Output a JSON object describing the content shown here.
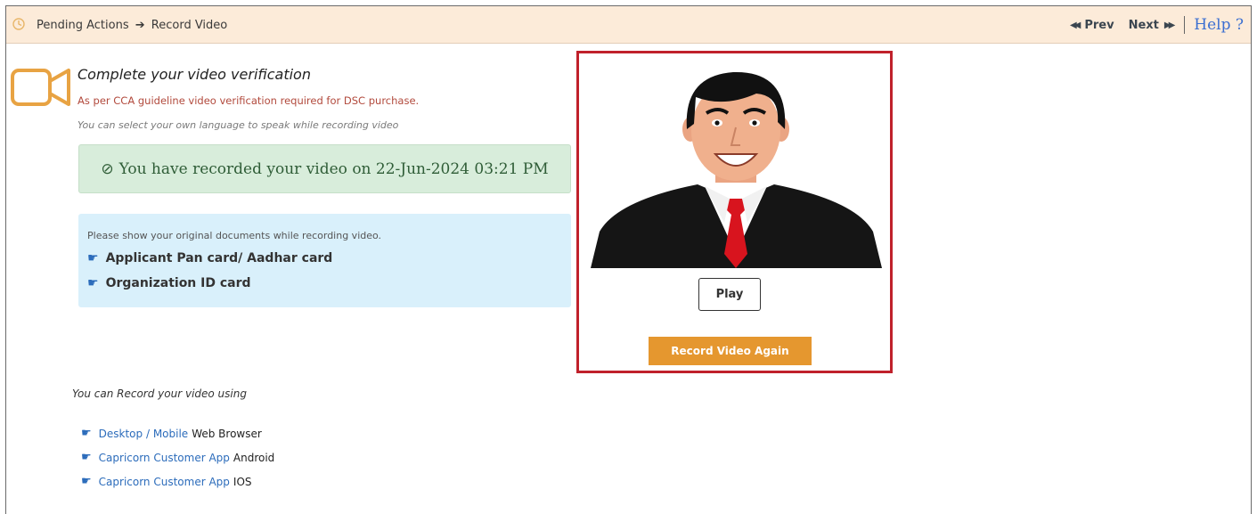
{
  "breadcrumb": {
    "parent": "Pending Actions",
    "current": "Record Video"
  },
  "nav": {
    "prev": "Prev",
    "next": "Next",
    "help": "Help ?"
  },
  "verification": {
    "title": "Complete your video verification",
    "requirement": "As per CCA guideline video verification required for DSC purchase.",
    "language_note": "You can select your own language to speak while recording video"
  },
  "status": {
    "message": "You have recorded your video on 22-Jun-2024 03:21 PM"
  },
  "documents": {
    "note": "Please show your original documents while recording video.",
    "items": [
      "Applicant Pan card/ Aadhar card",
      "Organization ID card"
    ]
  },
  "player": {
    "play_label": "Play",
    "record_again_label": "Record Video Again"
  },
  "record_using": {
    "heading": "You can Record your video using",
    "options": [
      {
        "link": "Desktop / Mobile",
        "text": "Web Browser"
      },
      {
        "link": "Capricorn Customer App",
        "text": "Android"
      },
      {
        "link": "Capricorn Customer App",
        "text": "IOS"
      }
    ]
  },
  "colors": {
    "topbar_bg": "#fcebd9",
    "accent_orange": "#e5972f",
    "highlight_red": "#c0212b",
    "success_bg": "#d8eddb",
    "info_bg": "#d9f0fb",
    "link_blue": "#2c6cbb"
  },
  "icons": {
    "breadcrumb": "clock-icon",
    "verification": "video-camera-icon",
    "status": "check-circle-icon",
    "bullet": "hand-pointer-icon"
  }
}
